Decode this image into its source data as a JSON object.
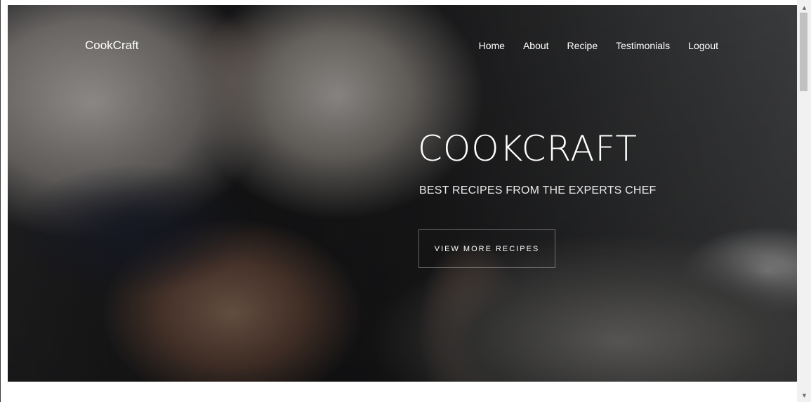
{
  "header": {
    "brand": "CookCraft",
    "nav": [
      {
        "label": "Home"
      },
      {
        "label": "About"
      },
      {
        "label": "Recipe"
      },
      {
        "label": "Testimonials"
      },
      {
        "label": "Logout"
      }
    ]
  },
  "hero": {
    "title": "COOKCRAFT",
    "subtitle": "BEST RECIPES FROM THE EXPERTS CHEF",
    "cta_label": "VIEW MORE RECIPES"
  },
  "scrollbar": {
    "up_icon": "triangle-up-icon",
    "down_icon": "triangle-down-icon"
  }
}
